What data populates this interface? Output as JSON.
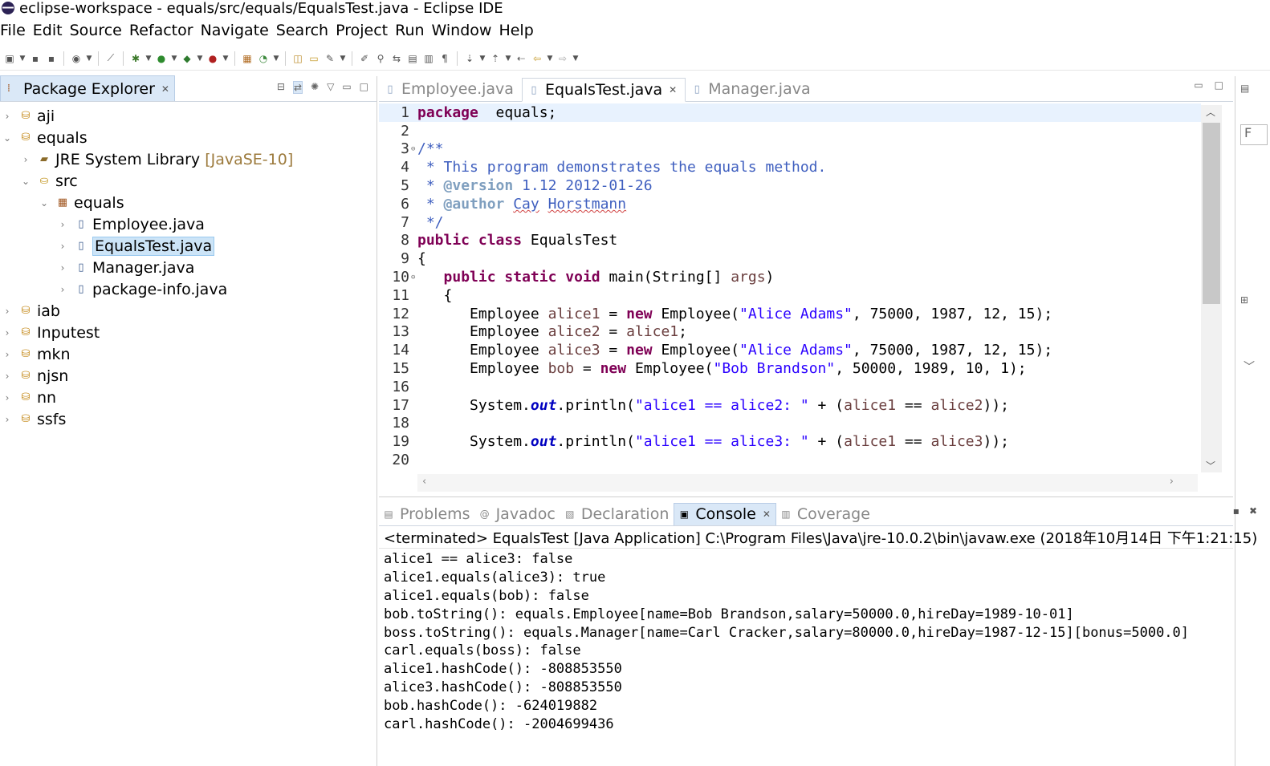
{
  "window": {
    "title": "eclipse-workspace - equals/src/equals/EqualsTest.java - Eclipse IDE"
  },
  "menu": [
    "File",
    "Edit",
    "Source",
    "Refactor",
    "Navigate",
    "Search",
    "Project",
    "Run",
    "Window",
    "Help"
  ],
  "explorer": {
    "title": "Package Explorer",
    "tree": [
      {
        "label": "aji",
        "qualifier": "",
        "icon": "project-icon",
        "expanded": false,
        "selected": false,
        "depth": 0
      },
      {
        "label": "equals",
        "qualifier": "",
        "icon": "project-icon",
        "expanded": true,
        "selected": false,
        "depth": 0
      },
      {
        "label": "JRE System Library",
        "qualifier": "[JavaSE-10]",
        "icon": "library-icon",
        "expanded": false,
        "selected": false,
        "depth": 1
      },
      {
        "label": "src",
        "qualifier": "",
        "icon": "source-folder-icon",
        "expanded": true,
        "selected": false,
        "depth": 1
      },
      {
        "label": "equals",
        "qualifier": "",
        "icon": "package-icon",
        "expanded": true,
        "selected": false,
        "depth": 2
      },
      {
        "label": "Employee.java",
        "qualifier": "",
        "icon": "java-file-icon",
        "expanded": false,
        "selected": false,
        "depth": 3
      },
      {
        "label": "EqualsTest.java",
        "qualifier": "",
        "icon": "java-file-icon",
        "expanded": false,
        "selected": true,
        "depth": 3
      },
      {
        "label": "Manager.java",
        "qualifier": "",
        "icon": "java-file-icon",
        "expanded": false,
        "selected": false,
        "depth": 3
      },
      {
        "label": "package-info.java",
        "qualifier": "",
        "icon": "java-file-icon",
        "expanded": false,
        "selected": false,
        "depth": 3
      },
      {
        "label": "iab",
        "qualifier": "",
        "icon": "project-icon",
        "expanded": false,
        "selected": false,
        "depth": 0
      },
      {
        "label": "Inputest",
        "qualifier": "",
        "icon": "project-icon",
        "expanded": false,
        "selected": false,
        "depth": 0
      },
      {
        "label": "mkn",
        "qualifier": "",
        "icon": "project-icon",
        "expanded": false,
        "selected": false,
        "depth": 0
      },
      {
        "label": "njsn",
        "qualifier": "",
        "icon": "project-icon",
        "expanded": false,
        "selected": false,
        "depth": 0
      },
      {
        "label": "nn",
        "qualifier": "",
        "icon": "project-icon",
        "expanded": false,
        "selected": false,
        "depth": 0
      },
      {
        "label": "ssfs",
        "qualifier": "",
        "icon": "project-icon",
        "expanded": false,
        "selected": false,
        "depth": 0
      }
    ]
  },
  "editor": {
    "tabs": [
      {
        "label": "Employee.java",
        "active": false
      },
      {
        "label": "EqualsTest.java",
        "active": true
      },
      {
        "label": "Manager.java",
        "active": false
      }
    ],
    "lines": [
      {
        "n": "1",
        "fold": "",
        "current": true,
        "tokens": [
          [
            "kw",
            "package"
          ],
          [
            "",
            "  equals;"
          ]
        ]
      },
      {
        "n": "2",
        "fold": "",
        "tokens": []
      },
      {
        "n": "3",
        "fold": "⊖",
        "tokens": [
          [
            "cm",
            "/**"
          ]
        ]
      },
      {
        "n": "4",
        "fold": "",
        "tokens": [
          [
            "cm",
            " * This program demonstrates the equals method."
          ]
        ]
      },
      {
        "n": "5",
        "fold": "",
        "tokens": [
          [
            "cm",
            " * "
          ],
          [
            "tag",
            "@version"
          ],
          [
            "cm",
            " 1.12 2012-01-26"
          ]
        ]
      },
      {
        "n": "6",
        "fold": "",
        "tokens": [
          [
            "cm",
            " * "
          ],
          [
            "tag",
            "@author"
          ],
          [
            "cm",
            " "
          ],
          [
            "cm squig",
            "Cay"
          ],
          [
            "cm",
            " "
          ],
          [
            "cm squig",
            "Horstmann"
          ]
        ]
      },
      {
        "n": "7",
        "fold": "",
        "tokens": [
          [
            "cm",
            " */"
          ]
        ]
      },
      {
        "n": "8",
        "fold": "",
        "tokens": [
          [
            "kw",
            "public"
          ],
          [
            "",
            " "
          ],
          [
            "kw",
            "class"
          ],
          [
            "",
            " EqualsTest"
          ]
        ]
      },
      {
        "n": "9",
        "fold": "",
        "tokens": [
          [
            "",
            "{"
          ]
        ]
      },
      {
        "n": "10",
        "fold": "⊖",
        "tokens": [
          [
            "",
            "   "
          ],
          [
            "kw",
            "public"
          ],
          [
            "",
            " "
          ],
          [
            "kw",
            "static"
          ],
          [
            "",
            " "
          ],
          [
            "kw",
            "void"
          ],
          [
            "",
            " main(String[] "
          ],
          [
            "var",
            "args"
          ],
          [
            "",
            ")"
          ]
        ]
      },
      {
        "n": "11",
        "fold": "",
        "tokens": [
          [
            "",
            "   {"
          ]
        ]
      },
      {
        "n": "12",
        "fold": "",
        "tokens": [
          [
            "",
            "      Employee "
          ],
          [
            "var",
            "alice1"
          ],
          [
            "",
            " = "
          ],
          [
            "kw",
            "new"
          ],
          [
            "",
            " Employee("
          ],
          [
            "str",
            "\"Alice Adams\""
          ],
          [
            "",
            ", 75000, 1987, 12, 15);"
          ]
        ]
      },
      {
        "n": "13",
        "fold": "",
        "tokens": [
          [
            "",
            "      Employee "
          ],
          [
            "var",
            "alice2"
          ],
          [
            "",
            " = "
          ],
          [
            "var",
            "alice1"
          ],
          [
            "",
            ";"
          ]
        ]
      },
      {
        "n": "14",
        "fold": "",
        "tokens": [
          [
            "",
            "      Employee "
          ],
          [
            "var",
            "alice3"
          ],
          [
            "",
            " = "
          ],
          [
            "kw",
            "new"
          ],
          [
            "",
            " Employee("
          ],
          [
            "str",
            "\"Alice Adams\""
          ],
          [
            "",
            ", 75000, 1987, 12, 15);"
          ]
        ]
      },
      {
        "n": "15",
        "fold": "",
        "tokens": [
          [
            "",
            "      Employee "
          ],
          [
            "var",
            "bob"
          ],
          [
            "",
            " = "
          ],
          [
            "kw",
            "new"
          ],
          [
            "",
            " Employee("
          ],
          [
            "str",
            "\"Bob Brandson\""
          ],
          [
            "",
            ", 50000, 1989, 10, 1);"
          ]
        ]
      },
      {
        "n": "16",
        "fold": "",
        "tokens": []
      },
      {
        "n": "17",
        "fold": "",
        "tokens": [
          [
            "",
            "      System."
          ],
          [
            "fld",
            "out"
          ],
          [
            "",
            ".println("
          ],
          [
            "str",
            "\"alice1 == alice2: \""
          ],
          [
            "",
            " + ("
          ],
          [
            "var",
            "alice1"
          ],
          [
            "",
            " == "
          ],
          [
            "var",
            "alice2"
          ],
          [
            "",
            "));"
          ]
        ]
      },
      {
        "n": "18",
        "fold": "",
        "tokens": []
      },
      {
        "n": "19",
        "fold": "",
        "tokens": [
          [
            "",
            "      System."
          ],
          [
            "fld",
            "out"
          ],
          [
            "",
            ".println("
          ],
          [
            "str",
            "\"alice1 == alice3: \""
          ],
          [
            "",
            " + ("
          ],
          [
            "var",
            "alice1"
          ],
          [
            "",
            " == "
          ],
          [
            "var",
            "alice3"
          ],
          [
            "",
            "));"
          ]
        ]
      },
      {
        "n": "20",
        "fold": "",
        "tokens": []
      }
    ]
  },
  "console": {
    "tabs": [
      {
        "label": "Problems",
        "icon": "problems-icon",
        "active": false
      },
      {
        "label": "Javadoc",
        "icon": "javadoc-icon",
        "active": false
      },
      {
        "label": "Declaration",
        "icon": "declaration-icon",
        "active": false
      },
      {
        "label": "Console",
        "icon": "console-icon",
        "active": true
      },
      {
        "label": "Coverage",
        "icon": "coverage-icon",
        "active": false
      }
    ],
    "header": "<terminated> EqualsTest [Java Application] C:\\Program Files\\Java\\jre-10.0.2\\bin\\javaw.exe (2018年10月14日 下午1:21:15)",
    "output": [
      "alice1 == alice3: false",
      "alice1.equals(alice3): true",
      "alice1.equals(bob): false",
      "bob.toString(): equals.Employee[name=Bob Brandson,salary=50000.0,hireDay=1989-10-01]",
      "boss.toString(): equals.Manager[name=Carl Cracker,salary=80000.0,hireDay=1987-12-15][bonus=5000.0]",
      "carl.equals(boss): false",
      "alice1.hashCode(): -808853550",
      "alice3.hashCode(): -808853550",
      "bob.hashCode(): -624019882",
      "carl.hashCode(): -2004699436"
    ]
  },
  "colors": {
    "keyword": "#7f0055",
    "comment": "#3f5fbf",
    "string": "#2a00ff",
    "selection": "#cce4f7",
    "active_tab": "#dae8f7"
  }
}
